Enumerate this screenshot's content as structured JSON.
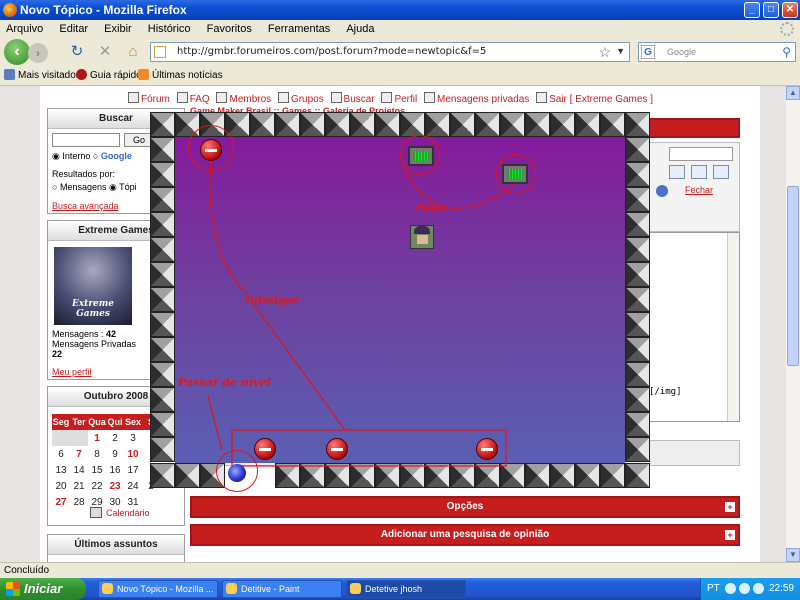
{
  "window": {
    "title": "Novo Tópico - Mozilla Firefox",
    "minimize": "_",
    "maximize": "□",
    "close": "✕"
  },
  "menu": [
    "Arquivo",
    "Editar",
    "Exibir",
    "Histórico",
    "Favoritos",
    "Ferramentas",
    "Ajuda"
  ],
  "nav": {
    "url": "http://gmbr.forumeiros.com/post.forum?mode=newtopic&f=5",
    "search_placeholder": "Google",
    "search_engine": "G"
  },
  "bookmarks": [
    "Mais visitados",
    "Guia rápido",
    "Últimas notícias"
  ],
  "page": {
    "top_links": [
      "Fórum",
      "FAQ",
      "Membros",
      "Grupos",
      "Buscar",
      "Perfil",
      "Mensagens privadas",
      "Sair [ Extreme Games ]"
    ],
    "breadcrumb": "Game Maker Brasil :: Games :: Galeria de Projetos",
    "search": {
      "title": "Buscar",
      "go": "Go",
      "opt_interno": "Interno",
      "opt_google": "Google",
      "results_by": "Resultados por:",
      "opt_mensagens": "Mensagens",
      "opt_topicos": "Tópi",
      "advanced": "Busca avançada"
    },
    "profile": {
      "title": "Extreme Games",
      "avatar_caption": "Extreme Games",
      "posts_label": "Mensagens :",
      "posts_value": "42",
      "pm_label": "Mensagens Privadas",
      "pm_value": "22",
      "my_profile": "Meu perfil"
    },
    "calendar": {
      "title": "Outubro 2008",
      "days": [
        "Seg",
        "Ter",
        "Qua",
        "Qui",
        "Sex",
        "S"
      ],
      "rows": [
        [
          "",
          "",
          "1",
          "2",
          "3",
          ""
        ],
        [
          "6",
          "7",
          "8",
          "9",
          "10",
          ""
        ],
        [
          "13",
          "14",
          "15",
          "16",
          "17",
          ""
        ],
        [
          "20",
          "21",
          "22",
          "23",
          "24",
          "2"
        ],
        [
          "27",
          "28",
          "29",
          "30",
          "31",
          ""
        ]
      ],
      "link": "Calendário"
    },
    "latest": "Últimos assuntos",
    "editor_close": "Fechar",
    "editor_tail": "[/img]",
    "opcoes": "Opções",
    "poll": "Adicionar uma pesquisa de opinião"
  },
  "game": {
    "annotations": {
      "enemies": "Inimigos",
      "next_level": "Passar de nível",
      "clues": "Pistas"
    }
  },
  "status": "Concluído",
  "taskbar": {
    "start": "Iniciar",
    "tasks": [
      "Novo Tópico - Mozilla ...",
      "Detitive - Paint",
      "Detetive jhosh"
    ],
    "lang": "PT",
    "clock": "22:59"
  }
}
